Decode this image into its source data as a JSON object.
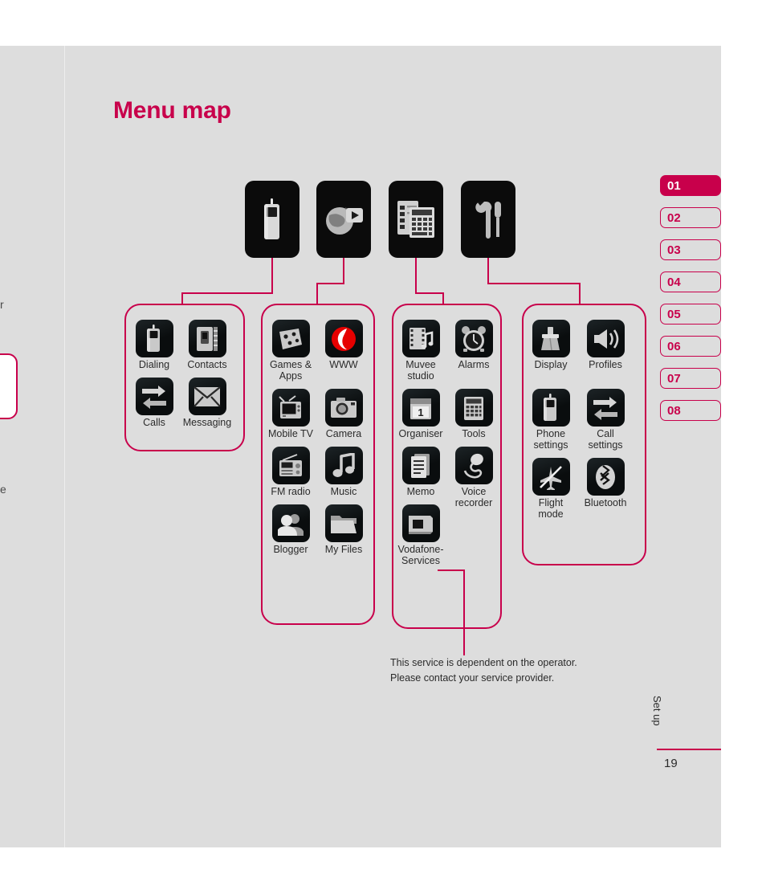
{
  "page": {
    "title": "Menu map",
    "chapter_label": "Set up",
    "page_number": "19",
    "accent_color": "#c8004b",
    "background_color": "#dddddd",
    "tile_color": "#0b0b0b"
  },
  "bleed": {
    "fragment_top": "r",
    "fragment_bottom": "e"
  },
  "top_level": [
    {
      "name": "phone-category",
      "icon": "mobile-phone-icon"
    },
    {
      "name": "media-category",
      "icon": "globe-media-icon"
    },
    {
      "name": "organiser-category",
      "icon": "organiser-calculator-icon"
    },
    {
      "name": "settings-category",
      "icon": "wrench-screwdriver-icon"
    }
  ],
  "groups": [
    {
      "name": "phone-group",
      "items": [
        {
          "label": "Dialing",
          "icon": "dialing-icon"
        },
        {
          "label": "Contacts",
          "icon": "contacts-icon"
        },
        {
          "label": "Calls",
          "icon": "calls-icon"
        },
        {
          "label": "Messaging",
          "icon": "messaging-icon"
        }
      ]
    },
    {
      "name": "media-group",
      "items": [
        {
          "label": "Games &\nApps",
          "icon": "games-apps-icon"
        },
        {
          "label": "WWW",
          "icon": "vodafone-www-icon"
        },
        {
          "label": "Mobile TV",
          "icon": "mobile-tv-icon"
        },
        {
          "label": "Camera",
          "icon": "camera-icon"
        },
        {
          "label": "FM radio",
          "icon": "fm-radio-icon"
        },
        {
          "label": "Music",
          "icon": "music-icon"
        },
        {
          "label": "Blogger",
          "icon": "blogger-icon"
        },
        {
          "label": "My Files",
          "icon": "my-files-icon"
        }
      ]
    },
    {
      "name": "organiser-group",
      "items": [
        {
          "label": "Muvee\nstudio",
          "icon": "muvee-studio-icon"
        },
        {
          "label": "Alarms",
          "icon": "alarms-icon"
        },
        {
          "label": "Organiser",
          "icon": "organiser-icon"
        },
        {
          "label": "Tools",
          "icon": "tools-calculator-icon"
        },
        {
          "label": "Memo",
          "icon": "memo-icon"
        },
        {
          "label": "Voice\nrecorder",
          "icon": "voice-recorder-icon"
        },
        {
          "label": "Vodafone-\nServices",
          "icon": "vodafone-services-icon"
        }
      ]
    },
    {
      "name": "settings-group",
      "items": [
        {
          "label": "Display",
          "icon": "display-icon"
        },
        {
          "label": "Profiles",
          "icon": "profiles-speaker-icon"
        },
        {
          "label": "Phone\nsettings",
          "icon": "phone-settings-icon"
        },
        {
          "label": "Call\nsettings",
          "icon": "call-settings-icon"
        },
        {
          "label": "Flight\nmode",
          "icon": "flight-mode-icon"
        },
        {
          "label": "Bluetooth",
          "icon": "bluetooth-icon"
        }
      ]
    }
  ],
  "footnote": "This service is dependent on the operator.\nPlease contact your service provider.",
  "tabs": [
    {
      "label": "01",
      "active": true
    },
    {
      "label": "02",
      "active": false
    },
    {
      "label": "03",
      "active": false
    },
    {
      "label": "04",
      "active": false
    },
    {
      "label": "05",
      "active": false
    },
    {
      "label": "06",
      "active": false
    },
    {
      "label": "07",
      "active": false
    },
    {
      "label": "08",
      "active": false
    }
  ]
}
